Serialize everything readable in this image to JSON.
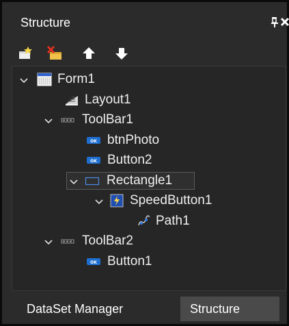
{
  "panel": {
    "title": "Structure"
  },
  "toolbar": {
    "buttons": [
      {
        "name": "add-icon"
      },
      {
        "name": "delete-icon"
      },
      {
        "name": "move-up-icon"
      },
      {
        "name": "move-down-icon"
      }
    ]
  },
  "tree": {
    "nodes": [
      {
        "label": "Form1",
        "icon": "form-icon",
        "expanded": true
      },
      {
        "label": "Layout1",
        "icon": "layout-icon"
      },
      {
        "label": "ToolBar1",
        "icon": "toolbar-icon",
        "expanded": true
      },
      {
        "label": "btnPhoto",
        "icon": "button-icon"
      },
      {
        "label": "Button2",
        "icon": "button-icon"
      },
      {
        "label": "Rectangle1",
        "icon": "rectangle-icon",
        "expanded": true,
        "selected": true
      },
      {
        "label": "SpeedButton1",
        "icon": "speedbutton-icon",
        "expanded": true
      },
      {
        "label": "Path1",
        "icon": "path-icon"
      },
      {
        "label": "ToolBar2",
        "icon": "toolbar-icon",
        "expanded": true
      },
      {
        "label": "Button1",
        "icon": "button-icon"
      }
    ]
  },
  "tabs": [
    {
      "label": "DataSet Manager",
      "active": false
    },
    {
      "label": "Structure",
      "active": true
    }
  ],
  "colors": {
    "background": "#2b2b2b",
    "tree_background": "#262626",
    "text": "#f0f0f0",
    "active_tab": "#4a4a4a",
    "accent_blue": "#1f6fd1"
  }
}
